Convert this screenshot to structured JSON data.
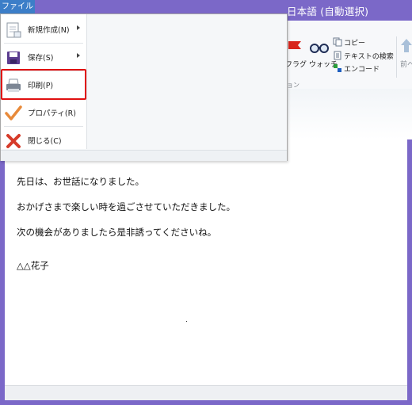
{
  "window": {
    "title": "日本語 (自動選択)"
  },
  "file_tab": {
    "label": "ファイル"
  },
  "file_menu": {
    "items": [
      {
        "label": "新規作成(N)",
        "icon": "new-document-icon",
        "submenu": true
      },
      {
        "label": "保存(S)",
        "icon": "floppy-disk-icon",
        "submenu": true
      },
      {
        "label": "印刷(P)",
        "icon": "printer-icon",
        "submenu": false,
        "highlighted": true
      },
      {
        "label": "プロパティ(R)",
        "icon": "checkmark-icon",
        "submenu": false
      },
      {
        "label": "閉じる(C)",
        "icon": "close-x-icon",
        "submenu": false
      }
    ]
  },
  "ribbon": {
    "flag_label": "フラグ",
    "watch_label": "ウォッチ",
    "copy_label": "コピー",
    "text_search_label": "テキストの検索",
    "encode_label": "エンコード",
    "prev_label": "前へ",
    "group_label_partial": "ョン"
  },
  "document": {
    "lines": [
      "先日は、お世話になりました。",
      "おかげさまで楽しい時を過ごさせていただきました。",
      "次の機会がありましたら是非誘ってくださいね。",
      "△△花子"
    ]
  },
  "colors": {
    "accent": "#7b68c8",
    "file_tab": "#3c7ec8",
    "highlight": "#e01010"
  }
}
